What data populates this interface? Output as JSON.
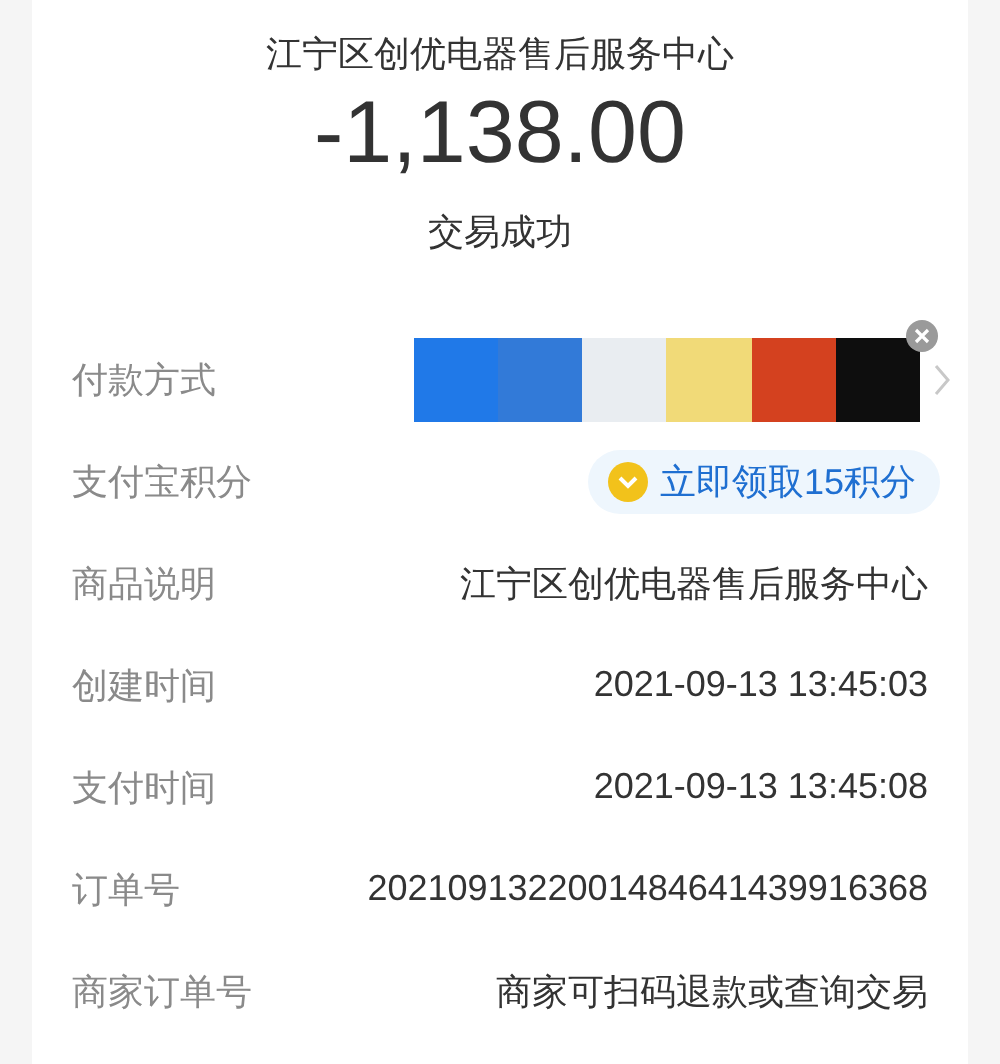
{
  "header": {
    "merchant": "江宁区创优电器售后服务中心",
    "amount": "-1,138.00",
    "status": "交易成功"
  },
  "rows": [
    {
      "kind": "swatches",
      "label": "付款方式",
      "swatches": [
        {
          "color": "#2079e8"
        },
        {
          "color": "#327ad8"
        },
        {
          "color": "#e9edf1"
        },
        {
          "color": "#f1da78"
        },
        {
          "color": "#d4411f"
        },
        {
          "color": "#0e0e0e"
        }
      ]
    },
    {
      "kind": "points",
      "label": "支付宝积分",
      "value": "立即领取15积分"
    },
    {
      "kind": "text",
      "label": "商品说明",
      "value": "江宁区创优电器售后服务中心"
    },
    {
      "kind": "text",
      "label": "创建时间",
      "value": "2021-09-13 13:45:03"
    },
    {
      "kind": "text",
      "label": "支付时间",
      "value": "2021-09-13 13:45:08"
    },
    {
      "kind": "text",
      "label": "订单号",
      "value": "2021091322001484641439916368"
    },
    {
      "kind": "text",
      "label": "商家订单号",
      "value": "商家可扫码退款或查询交易"
    }
  ]
}
